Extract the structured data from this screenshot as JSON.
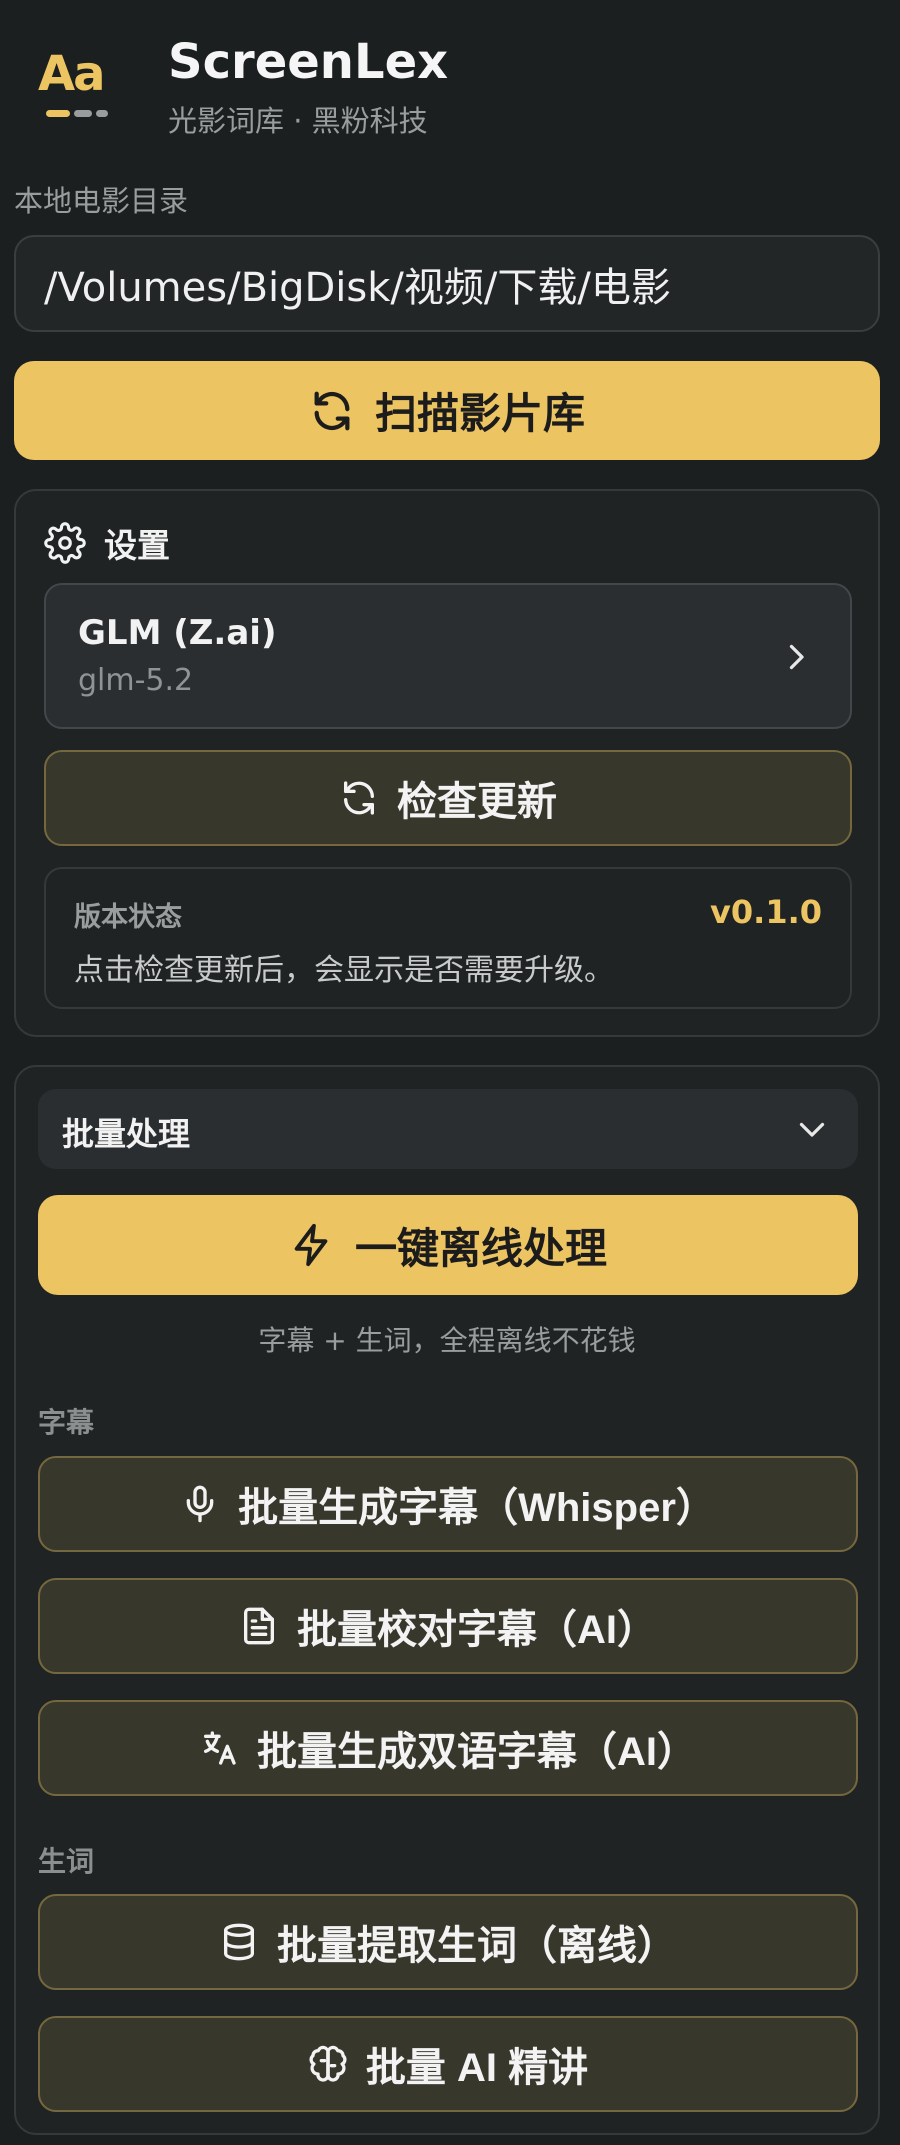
{
  "app": {
    "logo_text": "Aa",
    "title": "ScreenLex",
    "subtitle": "光影词库 · 黑粉科技"
  },
  "directory": {
    "label": "本地电影目录",
    "value": "/Volumes/BigDisk/视频/下载/电影"
  },
  "scan_button": {
    "label": "扫描影片库",
    "icon": "refresh-icon"
  },
  "settings": {
    "title": "设置",
    "icon": "gear-icon",
    "provider": {
      "name": "GLM (Z.ai)",
      "model": "glm-5.2"
    },
    "check_update_label": "检查更新",
    "version": {
      "label": "版本状态",
      "number": "v0.1.0",
      "description": "点击检查更新后，会显示是否需要升级。"
    }
  },
  "batch": {
    "title": "批量处理",
    "offline_button": {
      "label": "一键离线处理",
      "icon": "lightning-icon"
    },
    "offline_hint": "字幕 + 生词，全程离线不花钱",
    "subtitle_section": {
      "label": "字幕",
      "items": [
        {
          "label": "批量生成字幕（Whisper）",
          "icon": "microphone-icon"
        },
        {
          "label": "批量校对字幕（AI）",
          "icon": "document-icon"
        },
        {
          "label": "批量生成双语字幕（AI）",
          "icon": "translate-icon"
        }
      ]
    },
    "vocab_section": {
      "label": "生词",
      "items": [
        {
          "label": "批量提取生词（离线）",
          "icon": "database-icon"
        },
        {
          "label": "批量 AI 精讲",
          "icon": "brain-icon"
        }
      ]
    }
  },
  "colors": {
    "accent": "#ecc462",
    "background": "#1c1f1f",
    "secondary_button_bg": "#38372b",
    "secondary_button_border": "#75683e"
  }
}
